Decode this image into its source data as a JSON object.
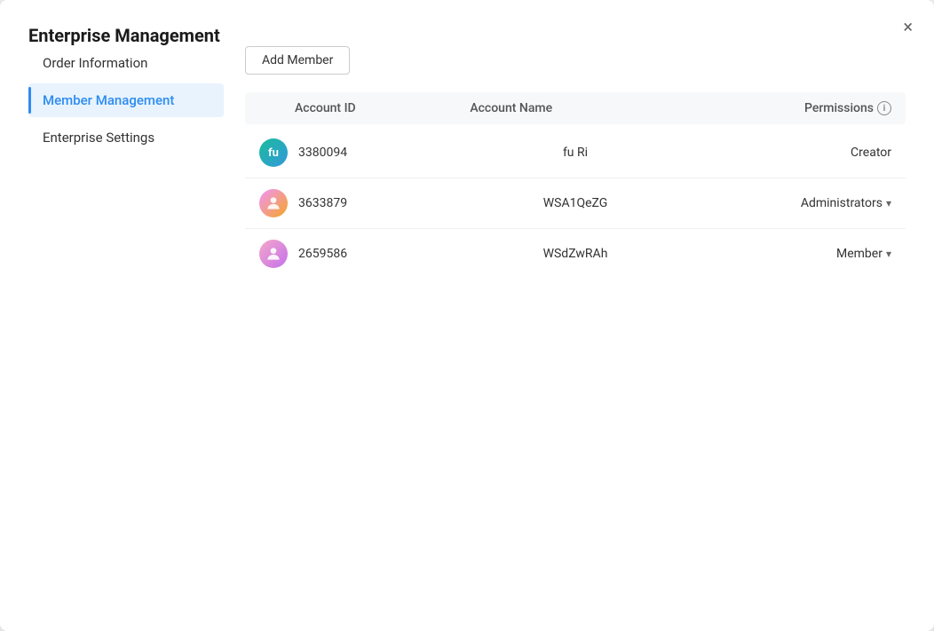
{
  "modal": {
    "title": "Enterprise Management",
    "close_label": "×"
  },
  "sidebar": {
    "items": [
      {
        "id": "order-information",
        "label": "Order Information",
        "active": false
      },
      {
        "id": "member-management",
        "label": "Member Management",
        "active": true
      },
      {
        "id": "enterprise-settings",
        "label": "Enterprise Settings",
        "active": false
      }
    ]
  },
  "main": {
    "add_member_btn": "Add Member",
    "table": {
      "headers": [
        {
          "id": "account-id",
          "label": "Account ID"
        },
        {
          "id": "account-name",
          "label": "Account Name"
        },
        {
          "id": "permissions",
          "label": "Permissions",
          "has_info": true
        }
      ],
      "rows": [
        {
          "avatar_type": "text",
          "avatar_text": "fu",
          "avatar_class": "avatar-fu",
          "account_id": "3380094",
          "account_name": "fu Ri",
          "permission": "Creator",
          "has_dropdown": false
        },
        {
          "avatar_type": "icon",
          "avatar_class": "avatar-img-1",
          "account_id": "3633879",
          "account_name": "WSA1QeZG",
          "permission": "Administrators",
          "has_dropdown": true
        },
        {
          "avatar_type": "icon",
          "avatar_class": "avatar-img-2",
          "account_id": "2659586",
          "account_name": "WSdZwRAh",
          "permission": "Member",
          "has_dropdown": true
        }
      ]
    }
  }
}
